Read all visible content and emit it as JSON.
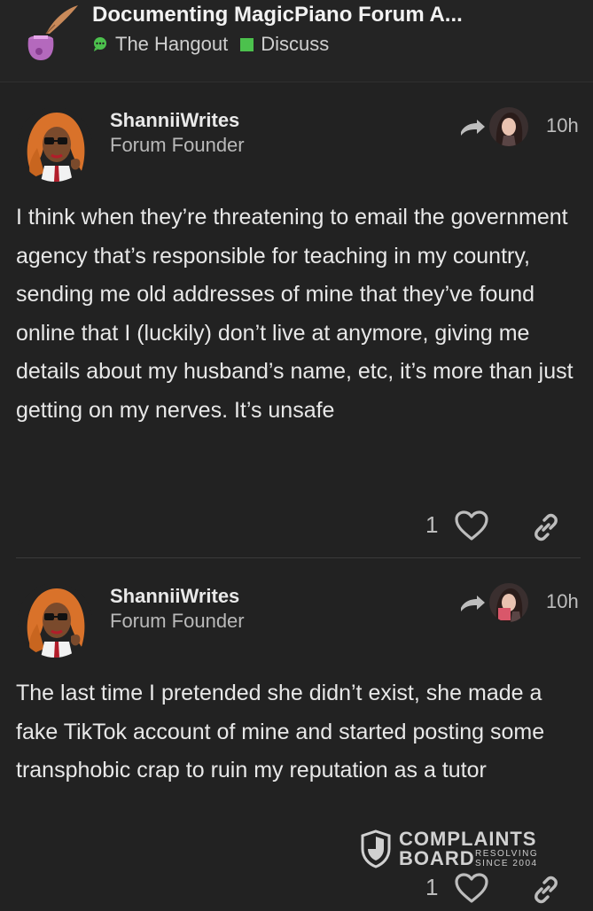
{
  "header": {
    "title": "Documenting MagicPiano Forum A...",
    "category": "The Hangout",
    "subcategory": "Discuss",
    "subcategory_color": "#4cc14d",
    "logo_icon": "potion-quill-icon"
  },
  "posts": [
    {
      "username": "ShanniiWrites",
      "user_title": "Forum Founder",
      "time": "10h",
      "body": "I think when they’re threatening to email the government agency that’s responsible for teaching in my country, sending me old addresses of mine that they’ve found online that I (luckily) don’t live at anymore, giving me details about my husband’s name, etc, it’s more than just getting on my nerves. It’s unsafe",
      "likes": "1"
    },
    {
      "username": "ShanniiWrites",
      "user_title": "Forum Founder",
      "time": "10h",
      "body": "The last time I pretended she didn’t exist, she made a fake TikTok account of mine and started posting some transphobic crap to ruin my reputation as a tutor",
      "likes": "1"
    }
  ],
  "watermark": {
    "line1": "COMPLAINTS",
    "line2": "BOARD",
    "tag1": "RESOLVING",
    "tag2": "SINCE 2004"
  }
}
